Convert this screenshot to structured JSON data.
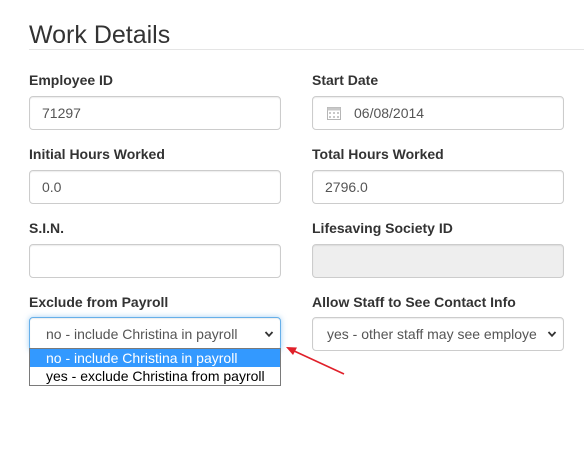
{
  "section_title": "Work Details",
  "fields": {
    "employee_id": {
      "label": "Employee ID",
      "value": "71297"
    },
    "start_date": {
      "label": "Start Date",
      "value": "06/08/2014",
      "icon": "calendar-icon"
    },
    "initial_hours": {
      "label": "Initial Hours Worked",
      "value": "0.0"
    },
    "total_hours": {
      "label": "Total Hours Worked",
      "value": "2796.0"
    },
    "sin": {
      "label": "S.I.N.",
      "value": ""
    },
    "lifesaving_id": {
      "label": "Lifesaving Society ID",
      "value": ""
    },
    "exclude_payroll": {
      "label": "Exclude from Payroll",
      "value": "no - include Christina in payroll",
      "options": [
        "no - include Christina in payroll",
        "yes - exclude Christina from payroll"
      ]
    },
    "allow_contact": {
      "label": "Allow Staff to See Contact Info",
      "value": "yes - other staff may see employe"
    }
  },
  "colors": {
    "focus": "#66afe9",
    "selected_option": "#3399ff",
    "annotation_arrow": "#e0202a"
  }
}
